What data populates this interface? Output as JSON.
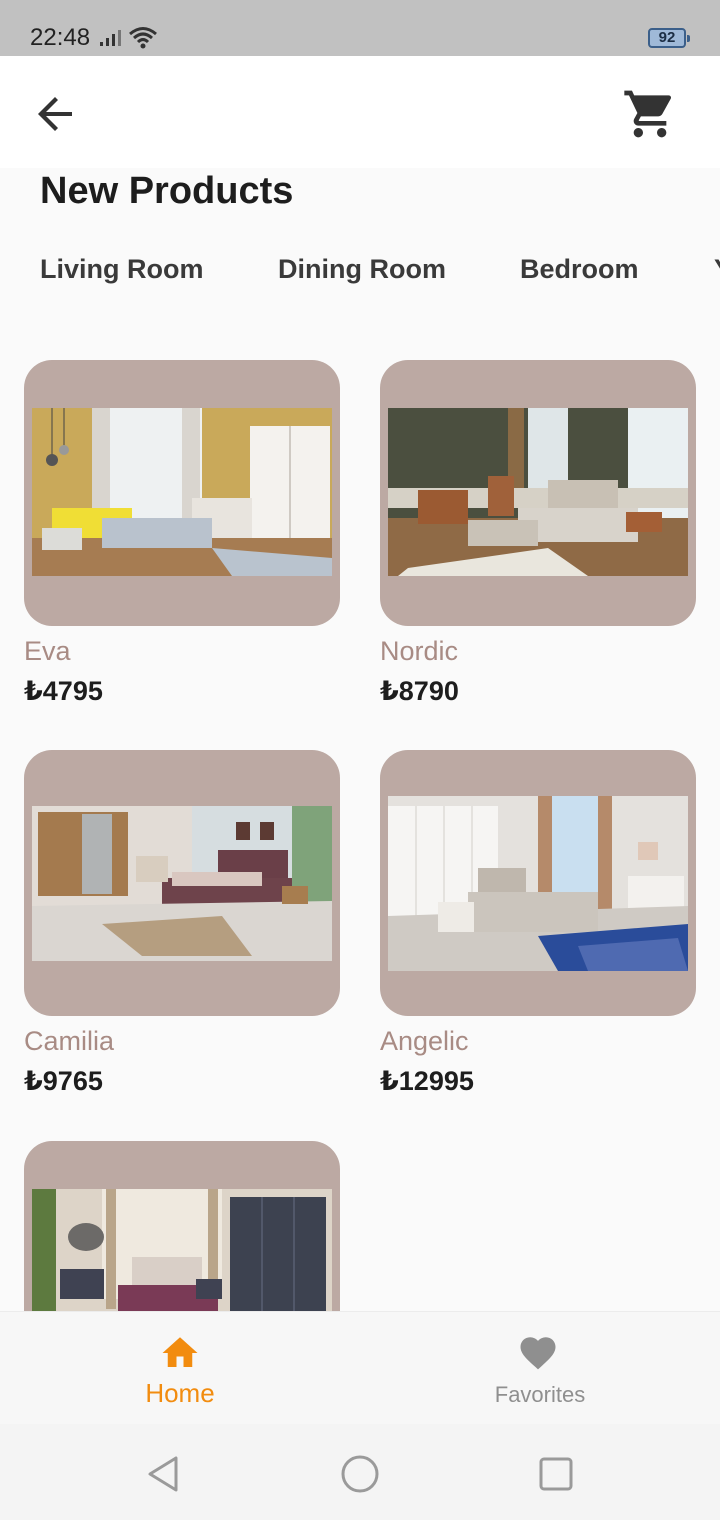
{
  "status": {
    "time": "22:48",
    "battery": "92"
  },
  "appbar": {
    "back_icon": "arrow-back-icon",
    "cart_icon": "shopping-cart-icon"
  },
  "page": {
    "title": "New Products"
  },
  "tabs": [
    {
      "label": "Living Room"
    },
    {
      "label": "Dining Room"
    },
    {
      "label": "Bedroom"
    },
    {
      "label": "Y"
    }
  ],
  "products": [
    {
      "name": "Eva",
      "price": "₺4795"
    },
    {
      "name": "Nordic",
      "price": "₺8790"
    },
    {
      "name": "Camilia",
      "price": "₺9765"
    },
    {
      "name": "Angelic",
      "price": "₺12995"
    },
    {
      "name": "",
      "price": ""
    }
  ],
  "bottom_nav": {
    "home": {
      "label": "Home",
      "icon": "home-icon"
    },
    "favorites": {
      "label": "Favorites",
      "icon": "heart-icon"
    }
  },
  "colors": {
    "accent": "#f28c0f",
    "card_bg": "#bca9a3",
    "product_name": "#a88b84",
    "inactive": "#8f8f8f"
  }
}
